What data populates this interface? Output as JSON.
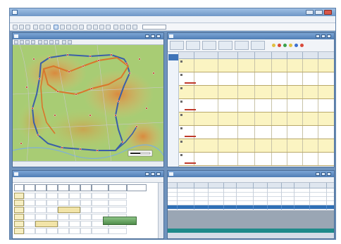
{
  "window": {
    "title": ""
  },
  "menu": {
    "items": [
      "",
      "",
      "",
      "",
      "",
      "",
      "",
      "",
      "",
      ""
    ]
  },
  "toolbar": {
    "combo_value": ""
  },
  "map_pane": {
    "title": ""
  },
  "jobs_pane": {
    "title": "",
    "columns": [
      "",
      "",
      "",
      "",
      "",
      "",
      "",
      "",
      ""
    ],
    "rows": [
      {
        "cells": [
          "",
          "",
          "",
          "",
          "",
          "",
          "",
          "",
          ""
        ],
        "flagged": false
      },
      {
        "cells": [
          "",
          "",
          "",
          "",
          "",
          "",
          "",
          "",
          ""
        ],
        "flagged": true
      },
      {
        "cells": [
          "",
          "",
          "",
          "",
          "",
          "",
          "",
          "",
          ""
        ],
        "flagged": false
      },
      {
        "cells": [
          "",
          "",
          "",
          "",
          "",
          "",
          "",
          "",
          ""
        ],
        "flagged": true
      },
      {
        "cells": [
          "",
          "",
          "",
          "",
          "",
          "",
          "",
          "",
          ""
        ],
        "flagged": false
      },
      {
        "cells": [
          "",
          "",
          "",
          "",
          "",
          "",
          "",
          "",
          ""
        ],
        "flagged": true
      },
      {
        "cells": [
          "",
          "",
          "",
          "",
          "",
          "",
          "",
          "",
          ""
        ],
        "flagged": false
      },
      {
        "cells": [
          "",
          "",
          "",
          "",
          "",
          "",
          "",
          "",
          ""
        ],
        "flagged": true
      }
    ]
  },
  "schedule_pane": {
    "title": "",
    "headers": [
      "",
      "",
      "",
      "",
      "",
      "",
      "",
      "",
      ""
    ]
  },
  "list_pane": {
    "title": "",
    "columns": [
      "",
      "",
      "",
      "",
      "",
      "",
      "",
      "",
      "",
      "",
      ""
    ],
    "rows": [
      {
        "cells": [
          "",
          "",
          "",
          "",
          "",
          "",
          "",
          "",
          "",
          "",
          ""
        ]
      },
      {
        "cells": [
          "",
          "",
          "",
          "",
          "",
          "",
          "",
          "",
          "",
          "",
          ""
        ]
      },
      {
        "cells": [
          "",
          "",
          "",
          "",
          "",
          "",
          "",
          "",
          "",
          "",
          ""
        ]
      },
      {
        "cells": [
          "",
          "",
          "",
          "",
          "",
          "",
          "",
          "",
          "",
          "",
          ""
        ]
      },
      {
        "cells": [
          "",
          "",
          "",
          "",
          "",
          "",
          "",
          "",
          "",
          "",
          ""
        ]
      }
    ],
    "selected_row": 4
  },
  "colors": {
    "route_blue": "#3b5fa8",
    "route_orange": "#d9762b",
    "row_yellow": "#fbf4c2",
    "selection": "#2f6fb6",
    "map_green": "#9cc46a",
    "map_orange": "#e6a65a"
  }
}
